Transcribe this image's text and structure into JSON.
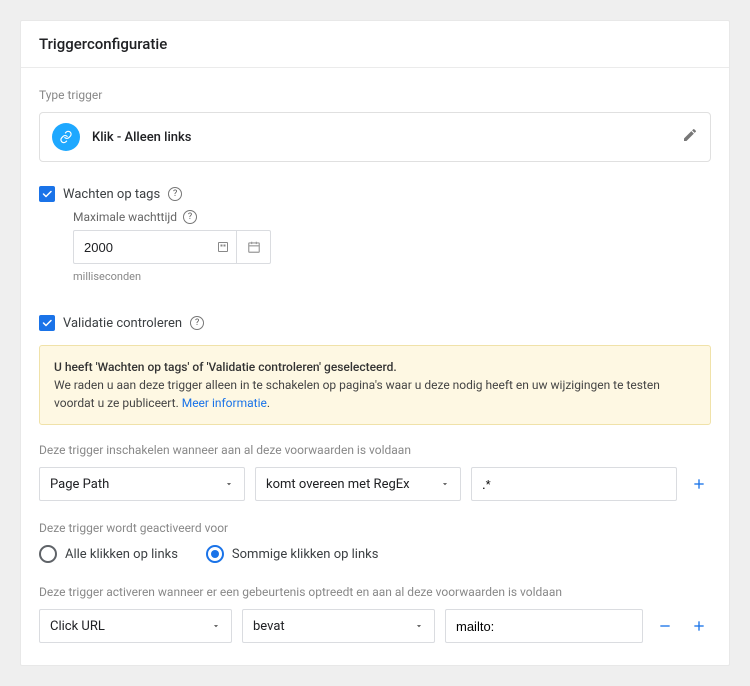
{
  "header": {
    "title": "Triggerconfiguratie"
  },
  "type_section": {
    "label": "Type trigger",
    "name": "Klik - Alleen links"
  },
  "wait": {
    "label": "Wachten op tags",
    "max_wait_label": "Maximale wachttijd",
    "max_wait_value": "2000",
    "unit_text": "milliseconden"
  },
  "validate": {
    "label": "Validatie controleren"
  },
  "notice": {
    "bold": "U heeft 'Wachten op tags' of 'Validatie controleren' geselecteerd.",
    "text": "We raden u aan deze trigger alleen in te schakelen op pagina's waar u deze nodig heeft en uw wijzigingen te testen voordat u ze publiceert. ",
    "link": "Meer informatie"
  },
  "enable_cond": {
    "label": "Deze trigger inschakelen wanneer aan al deze voorwaarden is voldaan",
    "var": "Page Path",
    "op": "komt overeen met RegEx",
    "value": ".*"
  },
  "fire_on": {
    "label": "Deze trigger wordt geactiveerd voor",
    "all": "Alle klikken op links",
    "some": "Sommige klikken op links"
  },
  "activate_cond": {
    "label": "Deze trigger activeren wanneer er een gebeurtenis optreedt en aan al deze voorwaarden is voldaan",
    "var": "Click URL",
    "op": "bevat",
    "value": "mailto:"
  }
}
